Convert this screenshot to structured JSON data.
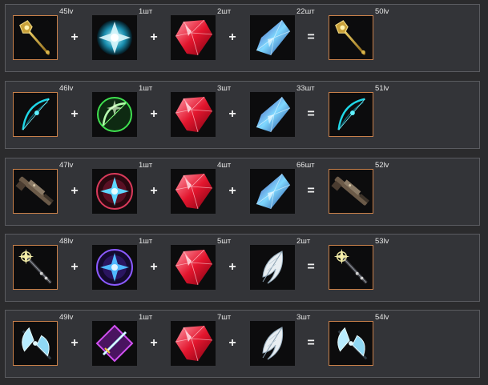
{
  "rows": [
    {
      "weapon": {
        "level": "45lv",
        "icon": "golden-staff-icon"
      },
      "essence": {
        "count": "1шт",
        "icon": "cyan-crystal-sigil-icon"
      },
      "ruby": {
        "count": "2шт",
        "icon": "red-gem-icon"
      },
      "third": {
        "count": "22шт",
        "icon": "blue-crystal-icon"
      },
      "result": {
        "level": "50lv",
        "icon": "golden-staff-icon"
      }
    },
    {
      "weapon": {
        "level": "46lv",
        "icon": "cyan-bow-icon"
      },
      "essence": {
        "count": "1шт",
        "icon": "green-bow-sigil-icon"
      },
      "ruby": {
        "count": "3шт",
        "icon": "red-gem-icon"
      },
      "third": {
        "count": "33шт",
        "icon": "blue-crystal-icon"
      },
      "result": {
        "level": "51lv",
        "icon": "cyan-bow-icon"
      }
    },
    {
      "weapon": {
        "level": "47lv",
        "icon": "rifle-icon"
      },
      "essence": {
        "count": "1шт",
        "icon": "red-crystal-sigil-icon"
      },
      "ruby": {
        "count": "4шт",
        "icon": "red-gem-icon"
      },
      "third": {
        "count": "66шт",
        "icon": "blue-crystal-icon"
      },
      "result": {
        "level": "52lv",
        "icon": "rifle-icon"
      }
    },
    {
      "weapon": {
        "level": "48lv",
        "icon": "dark-scepter-icon"
      },
      "essence": {
        "count": "1шт",
        "icon": "purple-crystal-sigil-icon"
      },
      "ruby": {
        "count": "5шт",
        "icon": "red-gem-icon"
      },
      "third": {
        "count": "2шт",
        "icon": "white-feather-icon"
      },
      "result": {
        "level": "53lv",
        "icon": "dark-scepter-icon"
      }
    },
    {
      "weapon": {
        "level": "49lv",
        "icon": "ice-axe-icon"
      },
      "essence": {
        "count": "1шт",
        "icon": "purple-sword-sigil-icon"
      },
      "ruby": {
        "count": "7шт",
        "icon": "red-gem-icon"
      },
      "third": {
        "count": "3шт",
        "icon": "white-feather-icon"
      },
      "result": {
        "level": "54lv",
        "icon": "ice-axe-icon"
      }
    }
  ],
  "symbols": {
    "plus": "+",
    "equals": "="
  }
}
